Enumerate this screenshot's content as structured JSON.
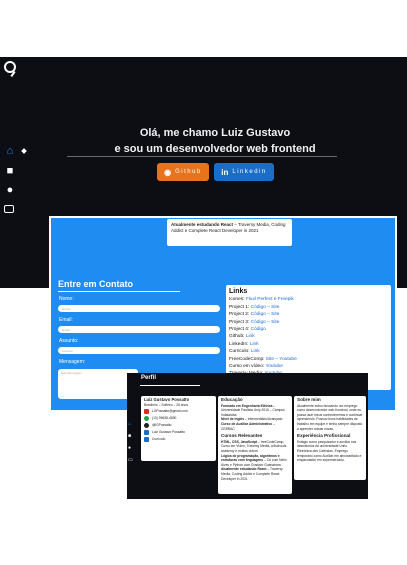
{
  "hero": {
    "line1": "Olá, me chamo Luiz Gustavo",
    "line2": "e sou um desenvolvedor web frontend",
    "github_label": "Github",
    "linkedin_label": "Linkedin"
  },
  "top_card": {
    "lead": "Atualmente estudando React",
    "rest": " – Traversy Media, Coding Addict e Complete React Developer in 2021"
  },
  "contact": {
    "title": "Entre em Contato",
    "name_label": "Nome:",
    "name_ph": "Nome",
    "email_label": "Email:",
    "email_ph": "Email",
    "subject_label": "Assunto:",
    "subject_ph": "Assunto",
    "message_label": "Mensagem:",
    "message_ph": "Sua Mensagem"
  },
  "links": {
    "title": "Links",
    "items": [
      {
        "label": "Icones: ",
        "link": "Fluxl Perfect e Freepik"
      },
      {
        "label": "Project 1: ",
        "link": "Código – Site"
      },
      {
        "label": "Project 2: ",
        "link": "Código – Site"
      },
      {
        "label": "Project 3: ",
        "link": "Código – Site"
      },
      {
        "label": "Project 4: ",
        "link": "Código"
      },
      {
        "label": "Github: ",
        "link": "Link"
      },
      {
        "label": "LinkedIn: ",
        "link": "Link"
      },
      {
        "label": "Curriculo: ",
        "link": "Link"
      },
      {
        "label": "FreeCodeComp: ",
        "link": "Site – Youtube"
      },
      {
        "label": "Curso em vídeo: ",
        "link": "Youtube"
      },
      {
        "label": "Traversy Media: ",
        "link": "Youtube"
      }
    ]
  },
  "profile": {
    "title": "Perfil",
    "name": "Luiz Gustavo Possatto",
    "subtitle": "Brasileiro – Solteiro – 26 anos",
    "email": "LGPossatto@gmail.com",
    "phone": "(13) 99638-4890",
    "github": "@lGPossatto",
    "linkedin": "Luiz Gustavo Possatto",
    "cv": "Currículo",
    "education_title": "Educação",
    "education": [
      {
        "lead": "Formado em Engenharia Elétrica",
        "rest": " – Universidade Paulista Unip 2016 – Câmpus Indaiatuba"
      },
      {
        "lead": "Nível de Inglês",
        "rest": " – Intermediário/Avançado"
      },
      {
        "lead": "Curso de Auxiliar Administrativo",
        "rest": " – CEBRAC"
      }
    ],
    "courses_title": "Cursos Relevantes",
    "courses": [
      {
        "lead": "HTML, CSS, JavaScript",
        "rest": " – freeCodeCamp, Curso em Vídeo, Traversy Media, w3schools academy e muitos outros."
      },
      {
        "lead": "Lógica de programação, algoritmos e estruturas com linguagens",
        "rest": " – C# com Nelio Alves e Python com Gustavo Guanabara"
      },
      {
        "lead": "Atualmente estudando React",
        "rest": " – Traversy Media, Coding Addict e Complete React Developer in 2021"
      }
    ],
    "about_title": "Sobre mim",
    "about": "Atualmente estou buscando um emprego como desenvolvedor web frontend, onde eu possa usar meus conhecimentos e continuar aprendendo. Possuo bons habilidades de trabalho em equipe e tenho sempre disposto a aprender coisas novas.",
    "experience_title": "Experiência Profissional",
    "experience": "Estágio como pesquisador e auxiliar nos laboratórios da universidade Unilo. Eletrônica dos Calendas. Emprego temporário como Auxiliar em almoxarifado e empacotador em supermercado."
  }
}
